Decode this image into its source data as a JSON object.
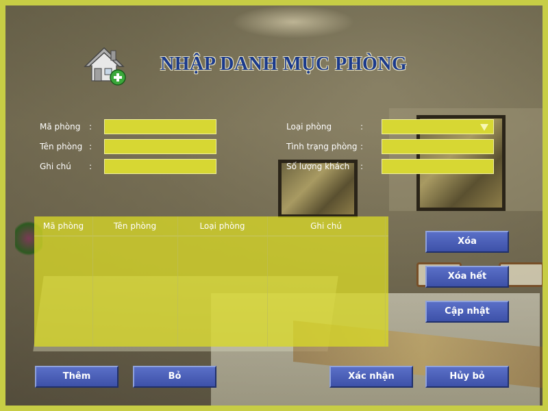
{
  "title": "NHẬP DANH MỤC PHÒNG",
  "form": {
    "ma_phong": {
      "label": "Mã phòng",
      "colon": ":",
      "value": ""
    },
    "ten_phong": {
      "label": "Tên phòng",
      "colon": ":",
      "value": ""
    },
    "ghi_chu": {
      "label": "Ghi chú",
      "colon": ":",
      "value": ""
    },
    "loai_phong": {
      "label": "Loại phòng",
      "colon": ":",
      "value": ""
    },
    "tinh_trang_phong": {
      "label": "Tình trạng phòng",
      "colon": ":",
      "value": ""
    },
    "so_luong_khach": {
      "label": "Số lượng khách",
      "colon": ":",
      "value": ""
    }
  },
  "grid": {
    "columns": [
      "Mã phòng",
      "Tên phòng",
      "Loại phòng",
      "Ghi chú"
    ],
    "rows": []
  },
  "buttons": {
    "xoa": "Xóa",
    "xoa_het": "Xóa hết",
    "cap_nhat": "Cập nhật",
    "them": "Thêm",
    "bo": "Bỏ",
    "xac_nhan": "Xác nhận",
    "huy_bo": "Hủy bỏ"
  },
  "icons": {
    "header": "house-add-icon",
    "dropdown": "chevron-down-icon"
  },
  "colors": {
    "frame_border": "#c7cd45",
    "field_bg": "#d7d733",
    "grid_bg": "#d7d728",
    "button_bg": "#4a5fb8",
    "title_color": "#1b3a8c"
  }
}
